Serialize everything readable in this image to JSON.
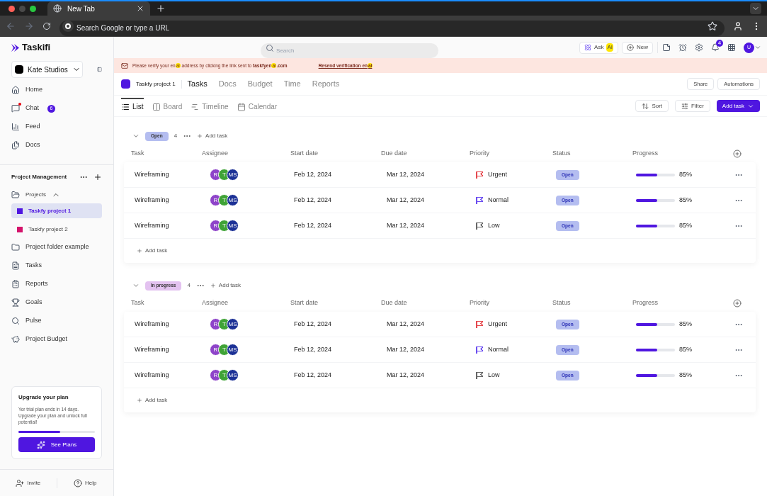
{
  "browser": {
    "tab_title": "New Tab",
    "address_placeholder": "Search Google or type a URL"
  },
  "sidebar": {
    "logo": "Taskifi",
    "workspace": "Kate Studios",
    "nav": [
      {
        "label": "Home"
      },
      {
        "label": "Chat",
        "badge": "6"
      },
      {
        "label": "Feed"
      },
      {
        "label": "Docs"
      }
    ],
    "section_title": "Project Management",
    "projects_label": "Projects",
    "projects": [
      {
        "label": "Taskfy project 1",
        "color": "#4f16e0",
        "selected": true
      },
      {
        "label": "Taskfy project 2",
        "color": "#d4136b",
        "selected": false
      }
    ],
    "items": [
      {
        "label": "Project folder example"
      },
      {
        "label": "Tasks"
      },
      {
        "label": "Reports"
      },
      {
        "label": "Goals"
      },
      {
        "label": "Pulse"
      },
      {
        "label": "Project Budget"
      }
    ],
    "upgrade": {
      "title": "Upgrade your plan",
      "text": "Yor trial plan ends in 14 days. Upgrade your plan and unlock full potential!",
      "level": 0.55,
      "button": "See Plans"
    },
    "footer": [
      "Invite",
      "Help"
    ]
  },
  "header": {
    "search_placeholder": "Search",
    "ask": "Ask",
    "ask_highlight": "AI",
    "new": "New",
    "notifications": "4",
    "avatar": "U"
  },
  "banner": {
    "segments": [
      {
        "kind": "text",
        "text": "Please verify your en"
      },
      {
        "kind": "highlight",
        "text": "ai"
      },
      {
        "kind": "text",
        "text": " address by clicking the link sent to "
      },
      {
        "kind": "bold",
        "text": "taskfyen"
      },
      {
        "kind": "highlight",
        "text": "ai"
      },
      {
        "kind": "bold",
        "text": ".com"
      }
    ],
    "link": "Resend verification en",
    "link_highlight": "ai"
  },
  "project": {
    "name": "Taskfy project 1",
    "color": "#4f16e0",
    "tabs": [
      {
        "label": "Tasks",
        "selected": true
      },
      {
        "label": "Docs",
        "selected": false
      },
      {
        "label": "Budget",
        "selected": false
      },
      {
        "label": "Time",
        "selected": false
      },
      {
        "label": "Reports",
        "selected": false
      }
    ],
    "actions": [
      "Share",
      "Automations"
    ]
  },
  "views": [
    {
      "label": "List",
      "selected": true
    },
    {
      "label": "Board",
      "selected": false
    },
    {
      "label": "Timeline",
      "selected": false
    },
    {
      "label": "Calendar",
      "selected": false
    }
  ],
  "toolbar": {
    "sort": "Sort",
    "filter": "Filter",
    "add": "Add task"
  },
  "groups": [
    {
      "status": "Open",
      "color": "#b4bdf0",
      "count": "4",
      "add": "Add task",
      "columns": [
        "Task",
        "Assignee",
        "Start date",
        "Due date",
        "Priority",
        "Status",
        "Progress"
      ],
      "rows": [
        {
          "task": "Wireframing",
          "assignees": [
            {
              "initials": "R",
              "color": "#8e44c9"
            },
            {
              "initials": "T",
              "color": "#3fa336"
            },
            {
              "initials": "MS",
              "color": "#1c3196"
            }
          ],
          "start": "Feb 12, 2024",
          "due": "Mar 12, 2024",
          "priority": {
            "label": "Urgent",
            "color": "#e5484d"
          },
          "status": "Open",
          "level": 0.55,
          "progress": "85%"
        },
        {
          "task": "Wireframing",
          "assignees": [
            {
              "initials": "R",
              "color": "#8e44c9"
            },
            {
              "initials": "T",
              "color": "#3fa336"
            },
            {
              "initials": "MS",
              "color": "#1c3196"
            }
          ],
          "start": "Feb 12, 2024",
          "due": "Mar 12, 2024",
          "priority": {
            "label": "Normal",
            "color": "#6a4cf0"
          },
          "status": "Open",
          "level": 0.55,
          "progress": "85%"
        },
        {
          "task": "Wireframing",
          "assignees": [
            {
              "initials": "R",
              "color": "#8e44c9"
            },
            {
              "initials": "T",
              "color": "#3fa336"
            },
            {
              "initials": "MS",
              "color": "#1c3196"
            }
          ],
          "start": "Feb 12, 2024",
          "due": "Mar 12, 2024",
          "priority": {
            "label": "Low",
            "color": "#666666"
          },
          "status": "Open",
          "level": 0.55,
          "progress": "85%"
        }
      ],
      "footer_add": "Add task"
    },
    {
      "status": "In progress",
      "color": "#e3c2f0",
      "count": "4",
      "add": "Add task",
      "columns": [
        "Task",
        "Assignee",
        "Start date",
        "Due date",
        "Priority",
        "Status",
        "Progress"
      ],
      "rows": [
        {
          "task": "Wireframing",
          "assignees": [
            {
              "initials": "R",
              "color": "#8e44c9"
            },
            {
              "initials": "T",
              "color": "#3fa336"
            },
            {
              "initials": "MS",
              "color": "#1c3196"
            }
          ],
          "start": "Feb 12, 2024",
          "due": "Mar 12, 2024",
          "priority": {
            "label": "Urgent",
            "color": "#e5484d"
          },
          "status": "Open",
          "level": 0.55,
          "progress": "85%"
        },
        {
          "task": "Wireframing",
          "assignees": [
            {
              "initials": "R",
              "color": "#8e44c9"
            },
            {
              "initials": "T",
              "color": "#3fa336"
            },
            {
              "initials": "MS",
              "color": "#1c3196"
            }
          ],
          "start": "Feb 12, 2024",
          "due": "Mar 12, 2024",
          "priority": {
            "label": "Normal",
            "color": "#6a4cf0"
          },
          "status": "Open",
          "level": 0.55,
          "progress": "85%"
        },
        {
          "task": "Wireframing",
          "assignees": [
            {
              "initials": "R",
              "color": "#8e44c9"
            },
            {
              "initials": "T",
              "color": "#3fa336"
            },
            {
              "initials": "MS",
              "color": "#1c3196"
            }
          ],
          "start": "Feb 12, 2024",
          "due": "Mar 12, 2024",
          "priority": {
            "label": "Low",
            "color": "#666666"
          },
          "status": "Open",
          "level": 0.55,
          "progress": "85%"
        }
      ],
      "footer_add": "Add task"
    }
  ]
}
